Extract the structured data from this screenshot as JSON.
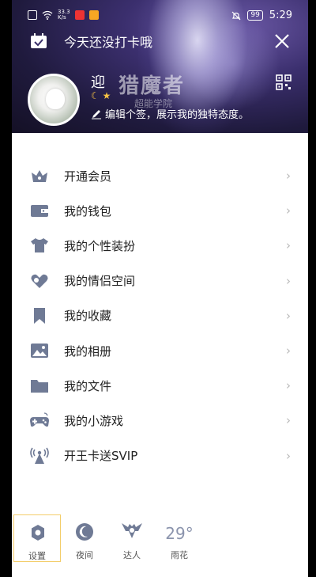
{
  "status_bar": {
    "network_speed_value": "33.3",
    "network_speed_unit": "K/s",
    "battery": "99",
    "time": "5:29"
  },
  "header": {
    "checkin_prompt": "今天还没打卡哦",
    "nickname": "迎",
    "signature": "编辑个签，展示我的独特态度。",
    "banner_logo": "猎魔者",
    "banner_sub": "超能学院"
  },
  "menu": [
    {
      "label": "开通会员",
      "icon": "crown-icon"
    },
    {
      "label": "我的钱包",
      "icon": "wallet-icon"
    },
    {
      "label": "我的个性装扮",
      "icon": "tshirt-icon"
    },
    {
      "label": "我的情侣空间",
      "icon": "heart-icon"
    },
    {
      "label": "我的收藏",
      "icon": "bookmark-icon"
    },
    {
      "label": "我的相册",
      "icon": "photo-icon"
    },
    {
      "label": "我的文件",
      "icon": "folder-icon"
    },
    {
      "label": "我的小游戏",
      "icon": "gamepad-icon"
    },
    {
      "label": "开王卡送SVIP",
      "icon": "signal-tower-icon"
    }
  ],
  "bottom_bar": {
    "settings": "设置",
    "night": "夜间",
    "expert": "达人",
    "temperature": "29°",
    "weather": "雨花"
  },
  "colors": {
    "menu_icon": "#6f7a95",
    "header_bg": "#2a2350",
    "highlight_border": "#f3cd6a"
  }
}
